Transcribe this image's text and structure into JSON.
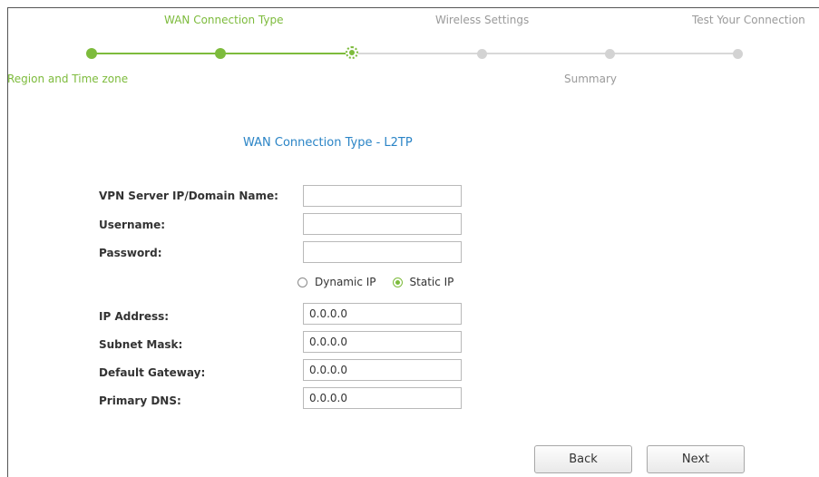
{
  "progress": {
    "steps_top": [
      {
        "label": "WAN Connection Type",
        "state": "done"
      },
      {
        "label": "Wireless Settings",
        "state": "todo"
      },
      {
        "label": "Test Your Connection",
        "state": "todo"
      }
    ],
    "steps_bottom": [
      {
        "label": "Region and Time zone",
        "state": "done"
      },
      {
        "label": "Summary",
        "state": "todo"
      }
    ],
    "completed_color": "#7dbb3c",
    "pending_color": "#d3d3d3"
  },
  "form": {
    "title": "WAN Connection Type - L2TP",
    "fields_top": [
      {
        "label": "VPN Server IP/Domain Name:",
        "value": ""
      },
      {
        "label": "Username:",
        "value": ""
      },
      {
        "label": "Password:",
        "value": ""
      }
    ],
    "ip_mode": {
      "options": [
        "Dynamic IP",
        "Static IP"
      ],
      "selected": "Static IP"
    },
    "fields_static": [
      {
        "label": "IP Address:",
        "value": "0.0.0.0"
      },
      {
        "label": "Subnet Mask:",
        "value": "0.0.0.0"
      },
      {
        "label": "Default Gateway:",
        "value": "0.0.0.0"
      },
      {
        "label": "Primary DNS:",
        "value": "0.0.0.0"
      }
    ]
  },
  "buttons": {
    "back": "Back",
    "next": "Next"
  },
  "colors": {
    "title": "#2a84c6",
    "accent": "#7dbb3c"
  }
}
